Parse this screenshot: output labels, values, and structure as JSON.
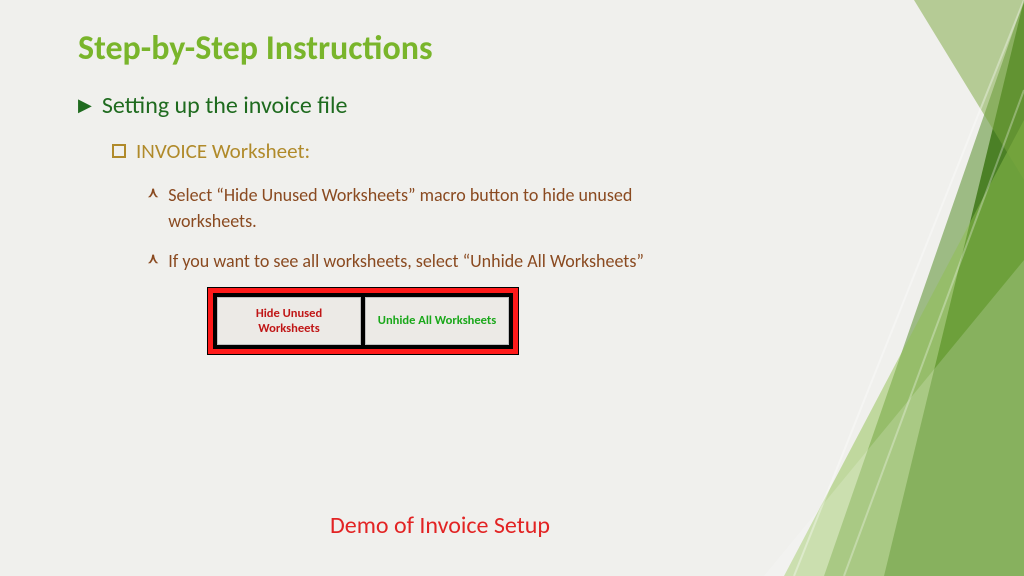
{
  "title": "Step-by-Step Instructions",
  "lvl1": "Setting up the invoice file",
  "lvl2": "INVOICE Worksheet:",
  "lvl3a": "Select “Hide Unused Worksheets” macro button to hide unused worksheets.",
  "lvl3b": "If you want to see all worksheets, select “Unhide All Worksheets”",
  "btn_hide": "Hide Unused Worksheets",
  "btn_unhide": "Unhide All Worksheets",
  "demo": "Demo of Invoice Setup"
}
